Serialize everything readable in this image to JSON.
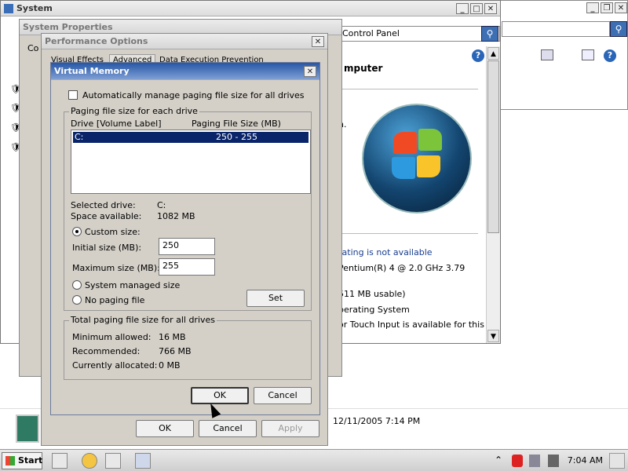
{
  "system_window": {
    "title": "System",
    "address": "Control Panel",
    "heading_partial": "mputer",
    "right_texts": {
      "line1": "n.",
      "rating": "rating is not available",
      "processor": "Pentium(R) 4   @ 2.0 GHz   3.79",
      "memory": "511 MB usable)",
      "os": "perating System",
      "touch": "or Touch Input is available for this"
    },
    "date_text": "12/11/2005 7:14 PM"
  },
  "system_properties": {
    "title": "System Properties",
    "tab_partial": "Co"
  },
  "performance_options": {
    "title": "Performance Options",
    "tabs": [
      "Visual Effects",
      "Advanced",
      "Data Execution Prevention"
    ],
    "ok": "OK",
    "cancel": "Cancel",
    "apply": "Apply"
  },
  "virtual_memory": {
    "title": "Virtual Memory",
    "auto_manage_label": "Automatically manage paging file size for all drives",
    "auto_manage_checked": false,
    "group1_label": "Paging file size for each drive",
    "col_drive": "Drive  [Volume Label]",
    "col_size": "Paging File Size (MB)",
    "drives": [
      {
        "drive": "C:",
        "size": "250 - 255",
        "selected": true
      }
    ],
    "selected_drive_label": "Selected drive:",
    "selected_drive_value": "C:",
    "space_label": "Space available:",
    "space_value": "1082 MB",
    "custom_size_label": "Custom size:",
    "initial_label": "Initial size (MB):",
    "initial_value": "250",
    "max_label": "Maximum size (MB):",
    "max_value": "255",
    "system_managed_label": "System managed size",
    "no_paging_label": "No paging file",
    "set_button": "Set",
    "group2_label": "Total paging file size for all drives",
    "min_label": "Minimum allowed:",
    "min_value": "16 MB",
    "rec_label": "Recommended:",
    "rec_value": "766 MB",
    "cur_label": "Currently allocated:",
    "cur_value": "0 MB",
    "ok": "OK",
    "cancel": "Cancel"
  },
  "taskbar": {
    "start": "Start",
    "time": "7:04 AM"
  }
}
